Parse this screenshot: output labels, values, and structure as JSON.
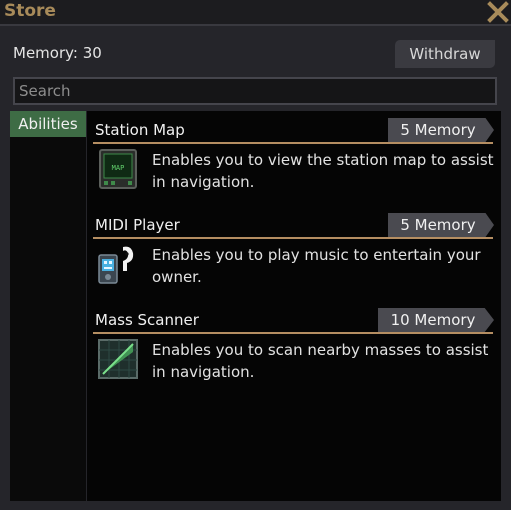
{
  "window": {
    "title": "Store"
  },
  "header": {
    "memory_label": "Memory: 30",
    "withdraw_label": "Withdraw"
  },
  "search": {
    "placeholder": "Search",
    "value": ""
  },
  "tabs": [
    {
      "label": "Abilities",
      "selected": true
    }
  ],
  "items": [
    {
      "name": "Station Map",
      "price": "5 Memory",
      "description": "Enables you to view the station map to assist in navigation.",
      "icon": "station-map-icon"
    },
    {
      "name": "MIDI Player",
      "price": "5 Memory",
      "description": "Enables you to play music to entertain your owner.",
      "icon": "midi-player-icon"
    },
    {
      "name": "Mass Scanner",
      "price": "10 Memory",
      "description": "Enables you to scan nearby masses to assist in navigation.",
      "icon": "mass-scanner-icon"
    }
  ],
  "colors": {
    "title": "#a88b5a",
    "tab_selected": "#3e6c45",
    "divider": "#b58e62",
    "price_bg": "#4a4a50"
  }
}
